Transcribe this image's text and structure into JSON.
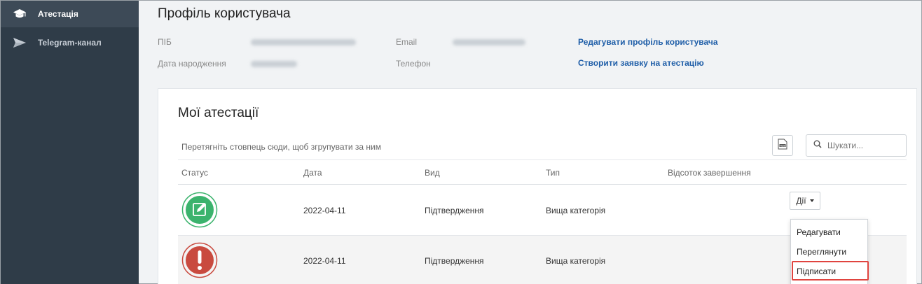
{
  "sidebar": {
    "items": [
      {
        "label": "Атестація",
        "icon": "graduation-cap-icon",
        "active": true
      },
      {
        "label": "Telegram-канал",
        "icon": "paper-plane-icon",
        "active": false
      }
    ]
  },
  "profile": {
    "title": "Профіль користувача",
    "fields": {
      "name_label": "ПІБ",
      "birth_label": "Дата народження",
      "email_label": "Email",
      "phone_label": "Телефон"
    },
    "links": {
      "edit_profile": "Редагувати профіль користувача",
      "create_request": "Створити заявку на атестацію"
    }
  },
  "attestations": {
    "title": "Мої атестації",
    "group_hint": "Перетягніть стовпець сюди, щоб згрупувати за ним",
    "export_icon": "excel-export-icon",
    "search_placeholder": "Шукати...",
    "columns": [
      "Статус",
      "Дата",
      "Вид",
      "Тип",
      "Відсоток завершення"
    ],
    "rows": [
      {
        "status_icon": "edit-status-icon",
        "date": "2022-04-11",
        "kind": "Підтвердження",
        "type": "Вища категорія",
        "percent": ""
      },
      {
        "status_icon": "warning-status-icon",
        "date": "2022-04-11",
        "kind": "Підтвердження",
        "type": "Вища категорія",
        "percent": ""
      }
    ],
    "actions": {
      "button_label": "Дії",
      "menu": [
        "Редагувати",
        "Переглянути",
        "Підписати"
      ],
      "highlighted": "Підписати"
    }
  },
  "colors": {
    "sidebar_bg": "#2f3c48",
    "link": "#1f5ea8",
    "status_green": "#3bb36d",
    "status_red": "#c94a3f",
    "highlight": "#e0443f"
  }
}
